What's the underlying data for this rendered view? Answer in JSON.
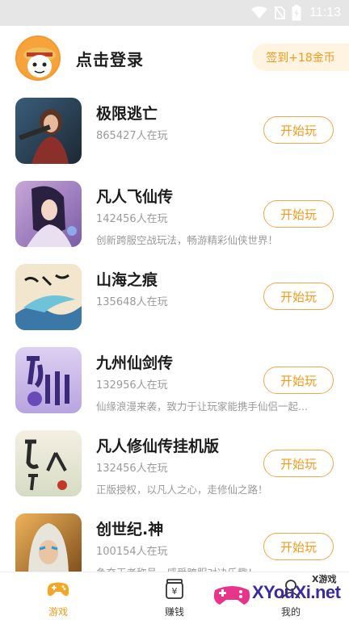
{
  "status_bar": {
    "time": "11:13",
    "icons": [
      "wifi-icon",
      "no-sim-icon",
      "battery-charging-icon"
    ]
  },
  "header": {
    "avatar": "avatar-icon",
    "login_label": "点击登录",
    "checkin_label": "签到+18金币"
  },
  "games": [
    {
      "name": "极限逃亡",
      "players": "865427人在玩",
      "desc": "",
      "button": "开始玩",
      "icon": "game-icon-jixian"
    },
    {
      "name": "凡人飞仙传",
      "players": "142456人在玩",
      "desc": "创新跨服空战玩法，畅游精彩仙侠世界！",
      "button": "开始玩",
      "icon": "game-icon-fanren-feixian"
    },
    {
      "name": "山海之痕",
      "players": "135648人在玩",
      "desc": "",
      "button": "开始玩",
      "icon": "game-icon-shanhai"
    },
    {
      "name": "九州仙剑传",
      "players": "132956人在玩",
      "desc": "仙缘浪漫来袭，致力于让玩家能携手仙侣一起...",
      "button": "开始玩",
      "icon": "game-icon-jiuzhou"
    },
    {
      "name": "凡人修仙传挂机版",
      "players": "132456人在玩",
      "desc": "正版授权，以凡人之心，走修仙之路！",
      "button": "开始玩",
      "icon": "game-icon-fanren-xiuxian"
    },
    {
      "name": "创世纪.神",
      "players": "100154人在玩",
      "desc": "争夺王者称号，感受跨服对决乐趣！",
      "button": "开始玩",
      "icon": "game-icon-chuangshiji"
    }
  ],
  "nav": {
    "items": [
      {
        "label": "游戏",
        "icon": "gamepad-icon",
        "active": true
      },
      {
        "label": "赚钱",
        "icon": "money-jar-icon",
        "active": false
      },
      {
        "label": "我的",
        "icon": "profile-icon",
        "active": false
      }
    ]
  },
  "watermark": {
    "site": "XYouXi.net",
    "sub": "X游戏"
  },
  "colors": {
    "accent": "#f39a1d",
    "checkin_bg": "#fff4e2",
    "muted_text": "#9a9a9a",
    "watermark": "#3a2b9e"
  }
}
